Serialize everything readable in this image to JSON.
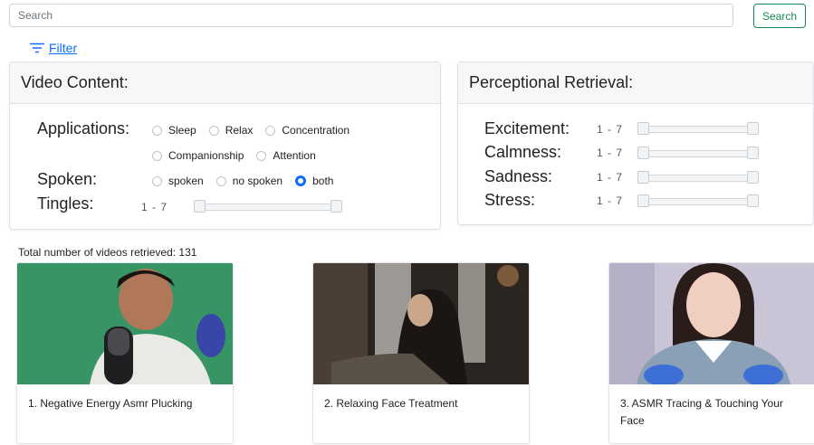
{
  "search": {
    "placeholder": "Search",
    "button_label": "Search"
  },
  "filter": {
    "label": "Filter"
  },
  "video_content": {
    "title": "Video Content:",
    "applications_label": "Applications:",
    "applications": [
      {
        "label": "Sleep",
        "checked": false
      },
      {
        "label": "Relax",
        "checked": false
      },
      {
        "label": "Concentration",
        "checked": false
      },
      {
        "label": "Companionship",
        "checked": false
      },
      {
        "label": "Attention",
        "checked": false
      }
    ],
    "spoken_label": "Spoken:",
    "spoken_options": [
      {
        "label": "spoken",
        "checked": false
      },
      {
        "label": "no spoken",
        "checked": false
      },
      {
        "label": "both",
        "checked": true
      }
    ],
    "tingles_label": "Tingles:",
    "tingles_range": "1 - 7",
    "tingles_min": 1,
    "tingles_max": 7
  },
  "perceptional": {
    "title": "Perceptional Retrieval:",
    "sliders": [
      {
        "label": "Excitement:",
        "range": "1 - 7",
        "min": 1,
        "max": 7
      },
      {
        "label": "Calmness:",
        "range": "1 - 7",
        "min": 1,
        "max": 7
      },
      {
        "label": "Sadness:",
        "range": "1 - 7",
        "min": 1,
        "max": 7
      },
      {
        "label": "Stress:",
        "range": "1 - 7",
        "min": 1,
        "max": 7
      }
    ]
  },
  "results": {
    "total_text": "Total number of videos retrieved: 131",
    "videos": [
      {
        "title": "1. Negative Energy Asmr Plucking"
      },
      {
        "title": "2. Relaxing Face Treatment"
      },
      {
        "title": "3. ASMR Tracing & Touching Your Face"
      }
    ]
  },
  "colors": {
    "accent": "#0d6efd",
    "search_button": "#198754"
  }
}
